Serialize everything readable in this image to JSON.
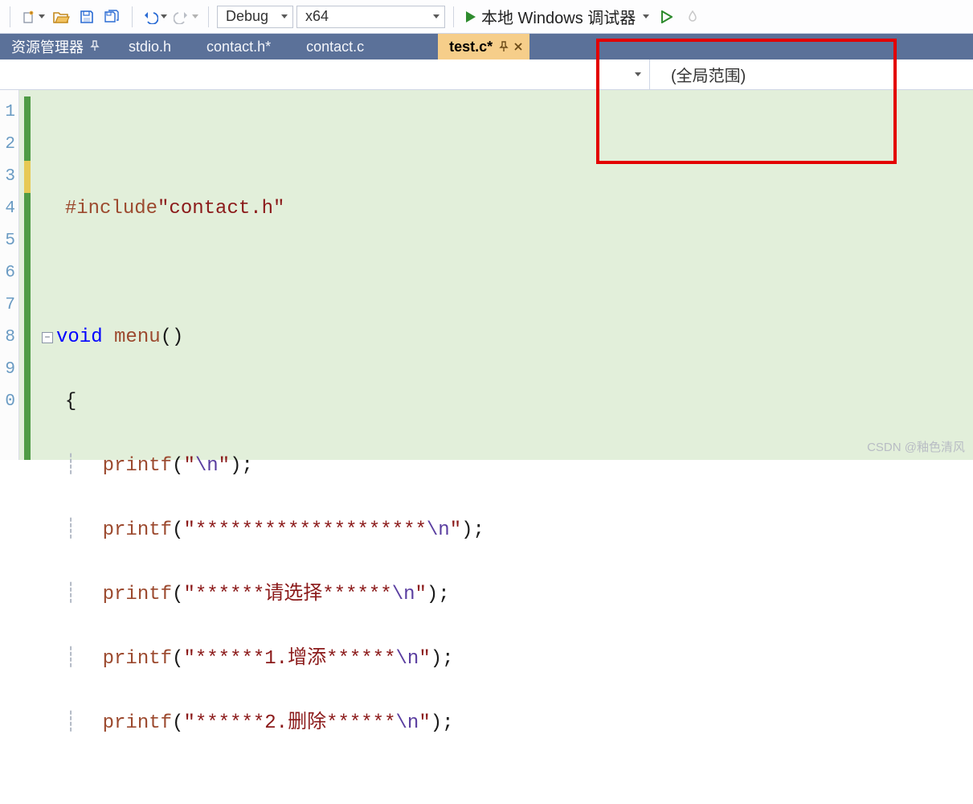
{
  "toolbar": {
    "config_select": "Debug",
    "platform_select": "x64",
    "debugger_label": "本地 Windows 调试器"
  },
  "panel": {
    "title": "资源管理器"
  },
  "tabs": {
    "t0": "stdio.h",
    "t1": "contact.h*",
    "t2": "contact.c",
    "t3": "test.c*"
  },
  "scope": {
    "label": "(全局范围)"
  },
  "line_numbers": [
    "1",
    "2",
    "3",
    "4",
    "5",
    "6",
    "7",
    "8",
    "9",
    "0"
  ],
  "code": {
    "l2_inc": "#include",
    "l2_path": "\"contact.h\"",
    "l4_void": "void",
    "l4_fn": "menu",
    "l4_par": "()",
    "l5_brace": "{",
    "l6_fn": "printf",
    "l6_a": "(",
    "l6_s": "\"",
    "l6_esc": "\\n",
    "l6_s2": "\"",
    "l6_b": ");",
    "l7_fn": "printf",
    "l7_a": "(",
    "l7_s": "\"********************",
    "l7_esc": "\\n",
    "l7_s2": "\"",
    "l7_b": ");",
    "l8_fn": "printf",
    "l8_a": "(",
    "l8_s": "\"******请选择******",
    "l8_esc": "\\n",
    "l8_s2": "\"",
    "l8_b": ");",
    "l9_fn": "printf",
    "l9_a": "(",
    "l9_s": "\"******1.增添******",
    "l9_esc": "\\n",
    "l9_s2": "\"",
    "l9_b": ");",
    "l10_fn": "printf",
    "l10_a": "(",
    "l10_s": "\"******2.删除******",
    "l10_esc": "\\n",
    "l10_s2": "\"",
    "l10_b": ");"
  },
  "watermark": "CSDN @釉色清风"
}
